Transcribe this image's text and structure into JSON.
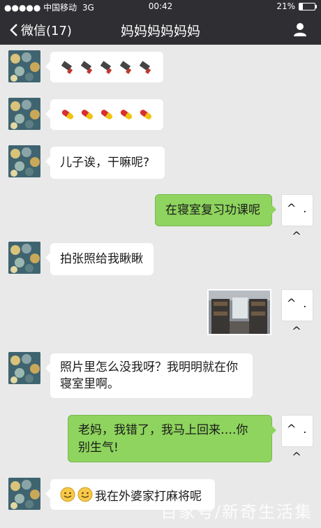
{
  "status": {
    "carrier": "●●●●● 中国移动",
    "network": "3G",
    "time": "00:42",
    "battery": "21%",
    "battery_level": 0.21
  },
  "nav": {
    "back_label": "微信(17)",
    "title": "妈妈妈妈妈妈"
  },
  "messages": [
    {
      "side": "left",
      "content": "5 razor icons"
    },
    {
      "side": "left",
      "content": "5 pill icons"
    },
    {
      "side": "left",
      "text": "儿子诶，干嘛呢?"
    },
    {
      "side": "right",
      "text": "在寝室复习功课呢"
    },
    {
      "side": "left",
      "text": "拍张照给我瞅瞅"
    },
    {
      "side": "right",
      "content": "dorm photo"
    },
    {
      "side": "left",
      "text_line1": "照片里怎么没我呀？我明明就在你",
      "text_line2": "寝室里啊。"
    },
    {
      "side": "right",
      "text_line1": "老妈，我错了，我马上回来….你",
      "text_line2": "别生气!"
    },
    {
      "side": "left",
      "text": "我在外婆家打麻将呢"
    }
  ],
  "self_avatar_text": "^ . ^",
  "watermark": "百家号/新奇生活集",
  "colors": {
    "bar": "#2f2f33",
    "background": "#e9e9ea",
    "outgoing_bubble": "#8ed45e",
    "incoming_bubble": "#ffffff"
  }
}
